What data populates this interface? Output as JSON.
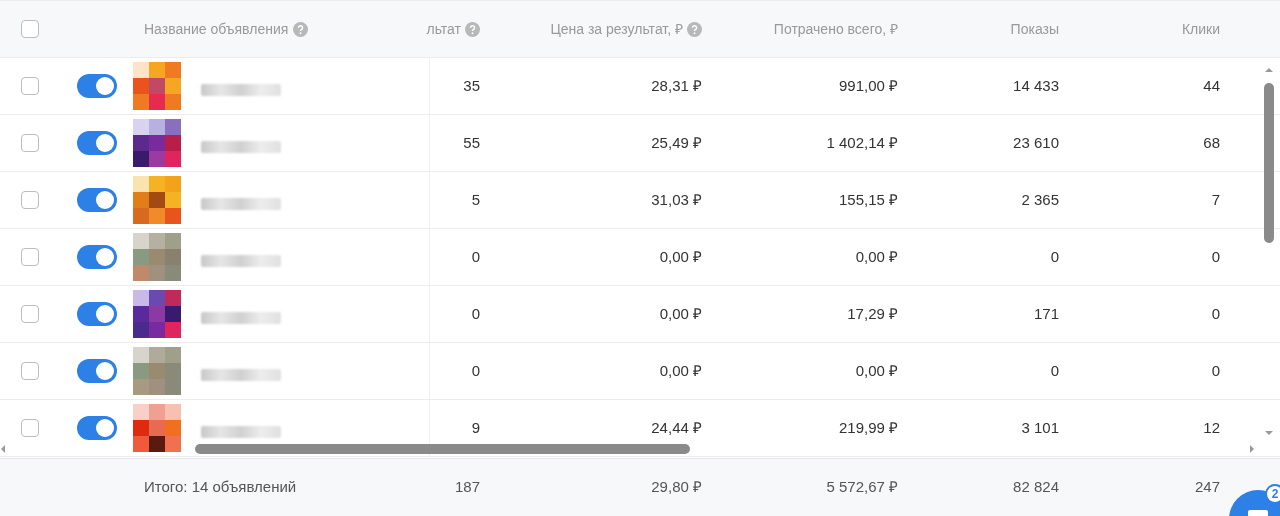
{
  "table": {
    "select_all": {
      "checked": false
    },
    "columns": [
      {
        "label": "Название объявления",
        "help": true
      },
      {
        "label": "льтат",
        "help": true
      },
      {
        "label": "Цена за результат, ₽",
        "help": true
      },
      {
        "label": "Потрачено всего, ₽",
        "help": false
      },
      {
        "label": "Показы",
        "help": false
      },
      {
        "label": "Клики",
        "help": false
      }
    ],
    "rows": [
      {
        "checked": false,
        "on": true,
        "result": "35",
        "price": "28,31 ₽",
        "spent": "991,00 ₽",
        "shows": "14 433",
        "clicks": "44"
      },
      {
        "checked": false,
        "on": true,
        "result": "55",
        "price": "25,49 ₽",
        "spent": "1 402,14 ₽",
        "shows": "23 610",
        "clicks": "68"
      },
      {
        "checked": false,
        "on": true,
        "result": "5",
        "price": "31,03 ₽",
        "spent": "155,15 ₽",
        "shows": "2 365",
        "clicks": "7"
      },
      {
        "checked": false,
        "on": true,
        "result": "0",
        "price": "0,00 ₽",
        "spent": "0,00 ₽",
        "shows": "0",
        "clicks": "0"
      },
      {
        "checked": false,
        "on": true,
        "result": "0",
        "price": "0,00 ₽",
        "spent": "17,29 ₽",
        "shows": "171",
        "clicks": "0"
      },
      {
        "checked": false,
        "on": true,
        "result": "0",
        "price": "0,00 ₽",
        "spent": "0,00 ₽",
        "shows": "0",
        "clicks": "0"
      },
      {
        "checked": false,
        "on": true,
        "result": "9",
        "price": "24,44 ₽",
        "spent": "219,99 ₽",
        "shows": "3 101",
        "clicks": "12"
      }
    ],
    "totals": {
      "label": "Итого: 14 объявлений",
      "result": "187",
      "price": "29,80 ₽",
      "spent": "5 572,67 ₽",
      "shows": "82 824",
      "clicks": "247"
    }
  },
  "chat": {
    "badge": "2"
  }
}
